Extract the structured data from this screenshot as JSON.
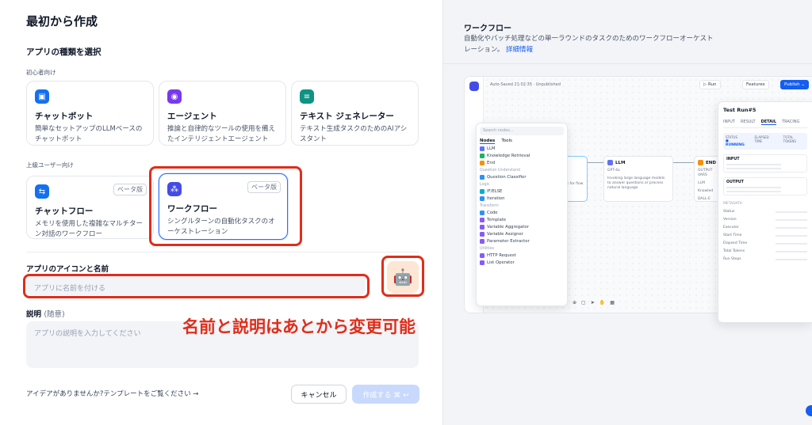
{
  "left": {
    "title": "最初から作成",
    "section_title": "アプリの種類を選択",
    "group_beginner": "初心者向け",
    "group_advanced": "上級ユーザー向け",
    "cards": [
      {
        "name": "チャットボット",
        "desc": "簡単なセットアップのLLMベースのチャットボット",
        "icon": "chat-icon",
        "color": "#1570ef"
      },
      {
        "name": "エージェント",
        "desc": "推論と自律的なツールの使用を備えたインテリジェントエージェント",
        "icon": "agent-icon",
        "color": "#7839ee"
      },
      {
        "name": "テキスト ジェネレーター",
        "desc": "テキスト生成タスクのためのAIアシスタント",
        "icon": "text-generator-icon",
        "color": "#0e9384"
      },
      {
        "name": "チャットフロー",
        "desc": "メモリを使用した複雑なマルチターン対話のワークフロー",
        "icon": "chatflow-icon",
        "color": "#1570ef",
        "badge": "ベータ版"
      },
      {
        "name": "ワークフロー",
        "desc": "シングルターンの自動化タスクのオーケストレーション",
        "icon": "workflow-icon",
        "color": "#444ce7",
        "badge": "ベータ版",
        "selected": true
      }
    ],
    "name_label": "アプリのアイコンと名前",
    "name_placeholder": "アプリに名前を付ける",
    "desc_label": "説明",
    "desc_optional": "(随意)",
    "desc_placeholder": "アプリの説明を入力してください",
    "annotation": "名前と説明はあとから変更可能",
    "template_link": "アイデアがありませんか?テンプレートをご覧ください →",
    "cancel": "キャンセル",
    "create": "作成する ⌘ ↩"
  },
  "right": {
    "title": "ワークフロー",
    "desc": "自動化やバッチ処理などの単一ラウンドのタスクのためのワークフローオーケストレーション。",
    "more": "詳細情報",
    "preview": {
      "autosave": "Auto-Saved 21:02:35 · Unpublished",
      "run": "▷ Run",
      "features": "Features",
      "publish": "Publish ⌄",
      "search": "Search nodes...",
      "tabs": [
        "Nodes",
        "Tools"
      ],
      "nodes": [
        {
          "cat": "",
          "items": [
            "LLM",
            "Knowledge Retrieval",
            "End"
          ]
        },
        {
          "cat": "Question Understand",
          "items": [
            "Question Classifier"
          ]
        },
        {
          "cat": "Logic",
          "items": [
            "IF/ELSE",
            "Iteration"
          ]
        },
        {
          "cat": "Transform",
          "items": [
            "Code",
            "Template",
            "Variable Aggregator",
            "Variable Assigner",
            "Parameter Extractor"
          ]
        },
        {
          "cat": "Utilities",
          "items": [
            "HTTP Request",
            "List Operator"
          ]
        }
      ],
      "llm_node": {
        "title": "LLM",
        "model": "GPT-4o",
        "desc": "Invoking large language models to answer questions or process natural language"
      },
      "start_desc": "parameters for flow",
      "end_node": "END",
      "end_out": "OUTPUT VARS",
      "end_vars": [
        "LLM",
        "Knowled",
        "DALL-E"
      ],
      "test_run": "Test Run#5",
      "test_tabs": [
        "INPUT",
        "RESULT",
        "DETAIL",
        "TRACING"
      ],
      "status_label": "STATUS",
      "status_value": "● RUNNING",
      "elapsed_label": "ELAPSED TIME",
      "tokens_label": "TOTAL TOKENS",
      "input": "INPUT",
      "output": "OUTPUT",
      "metadata": "METADATA",
      "meta_rows": [
        "Status",
        "Version",
        "Executor",
        "Start Time",
        "Elapsed Time",
        "Total Tokens",
        "Run Steps"
      ]
    }
  }
}
